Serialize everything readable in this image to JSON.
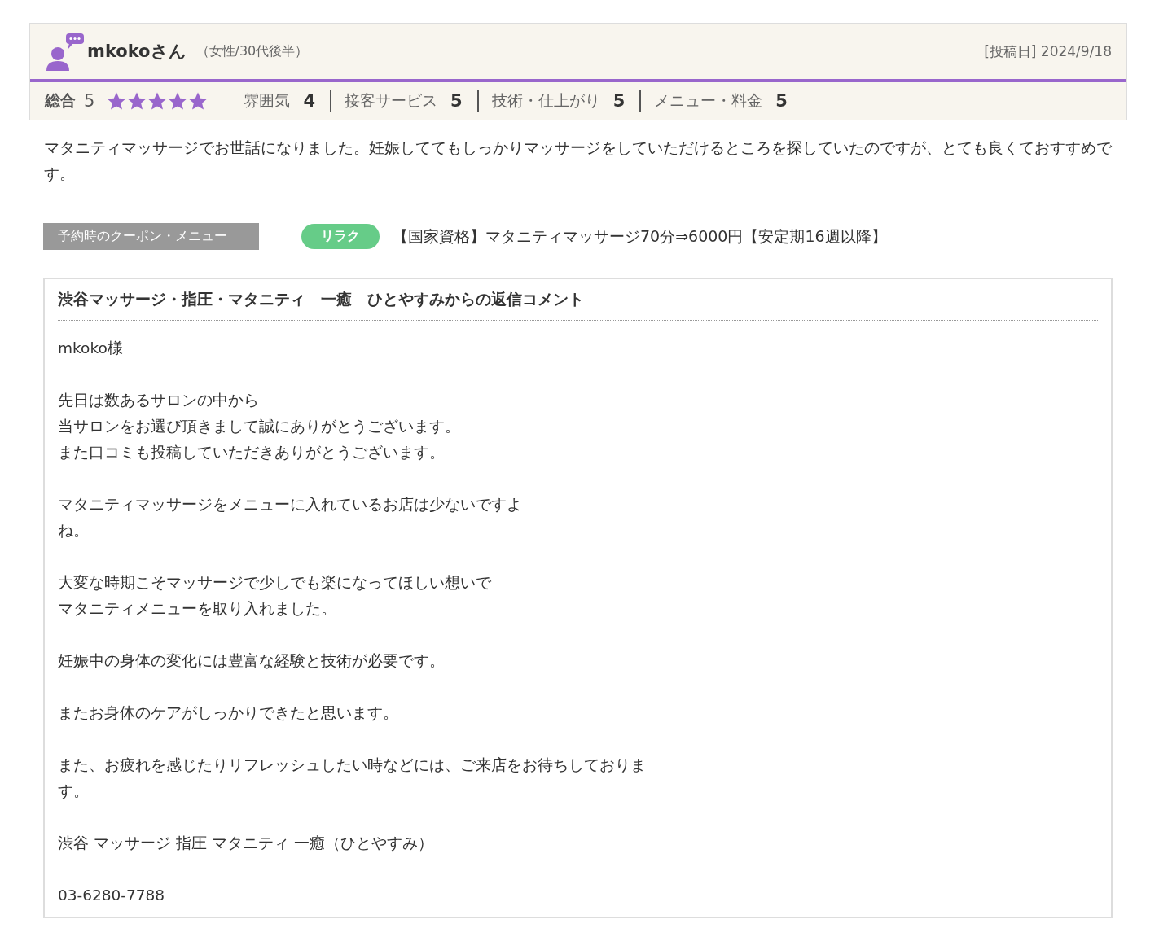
{
  "review": {
    "user_name": "mkokoさん",
    "user_profile": "（女性/30代後半）",
    "posted_date": "[投稿日] 2024/9/18",
    "overall_label": "総合",
    "overall_score": "5",
    "stars": 5,
    "ratings": [
      {
        "label": "雰囲気",
        "score": "4"
      },
      {
        "label": "接客サービス",
        "score": "5"
      },
      {
        "label": "技術・仕上がり",
        "score": "5"
      },
      {
        "label": "メニュー・料金",
        "score": "5"
      }
    ],
    "body": "マタニティマッサージでお世話になりました。妊娠しててもしっかりマッサージをしていただけるところを探していたのですが、とても良くておすすめです。",
    "coupon_label": "予約時のクーポン・メニュー",
    "coupon_tag": "リラク",
    "coupon_name": "【国家資格】マタニティマッサージ70分⇒6000円【安定期16週以降】"
  },
  "reply": {
    "title": "渋谷マッサージ・指圧・マタニティ　一癒　ひとやすみからの返信コメント",
    "paragraphs": [
      [
        "mkoko様"
      ],
      [
        "先日は数あるサロンの中から",
        "当サロンをお選び頂きまして誠にありがとうございます。",
        "また口コミも投稿していただきありがとうございます。"
      ],
      [
        "マタニティマッサージをメニューに入れているお店は少ないですよ",
        "ね。"
      ],
      [
        "大変な時期こそマッサージで少しでも楽になってほしい想いで",
        "マタニティメニューを取り入れました。"
      ],
      [
        "妊娠中の身体の変化には豊富な経験と技術が必要です。"
      ],
      [
        "またお身体のケアがしっかりできたと思います。"
      ],
      [
        "また、お疲れを感じたりリフレッシュしたい時などには、ご来店をお待ちしておりま",
        "す。"
      ],
      [
        "渋谷 マッサージ 指圧 マタニティ 一癒（ひとやすみ）"
      ],
      [
        "03-6280-7788"
      ]
    ]
  }
}
